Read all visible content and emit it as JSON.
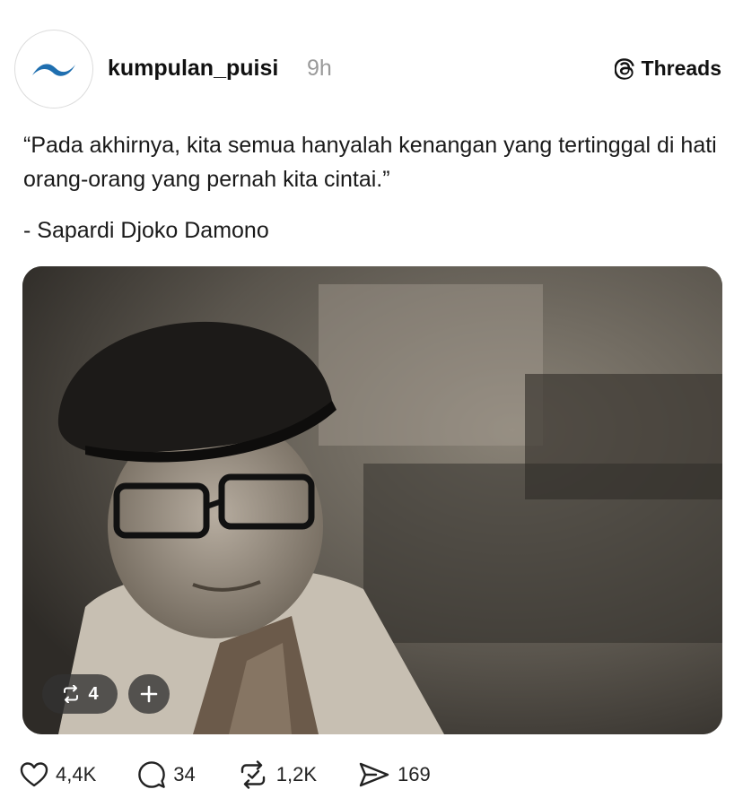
{
  "post": {
    "username": "kumpulan_puisi",
    "time": "9h",
    "platform": "Threads",
    "text": "“Pada akhirnya, kita semua hanyalah kenangan yang tertinggal di hati orang-orang yang pernah kita cintai.”",
    "author_line": "- Sapardi Djoko Damono"
  },
  "media": {
    "repost_count": "4"
  },
  "actions": {
    "likes": "4,4K",
    "replies": "34",
    "reposts": "1,2K",
    "shares": "169"
  },
  "icons": {
    "avatar": "wave-logo-icon",
    "threads": "threads-logo-icon",
    "like": "heart-icon",
    "reply": "comment-icon",
    "repost": "repost-icon",
    "share": "send-icon",
    "add": "plus-icon"
  },
  "colors": {
    "logo_blue": "#1f6fb0",
    "muted": "#9a9a9a"
  }
}
